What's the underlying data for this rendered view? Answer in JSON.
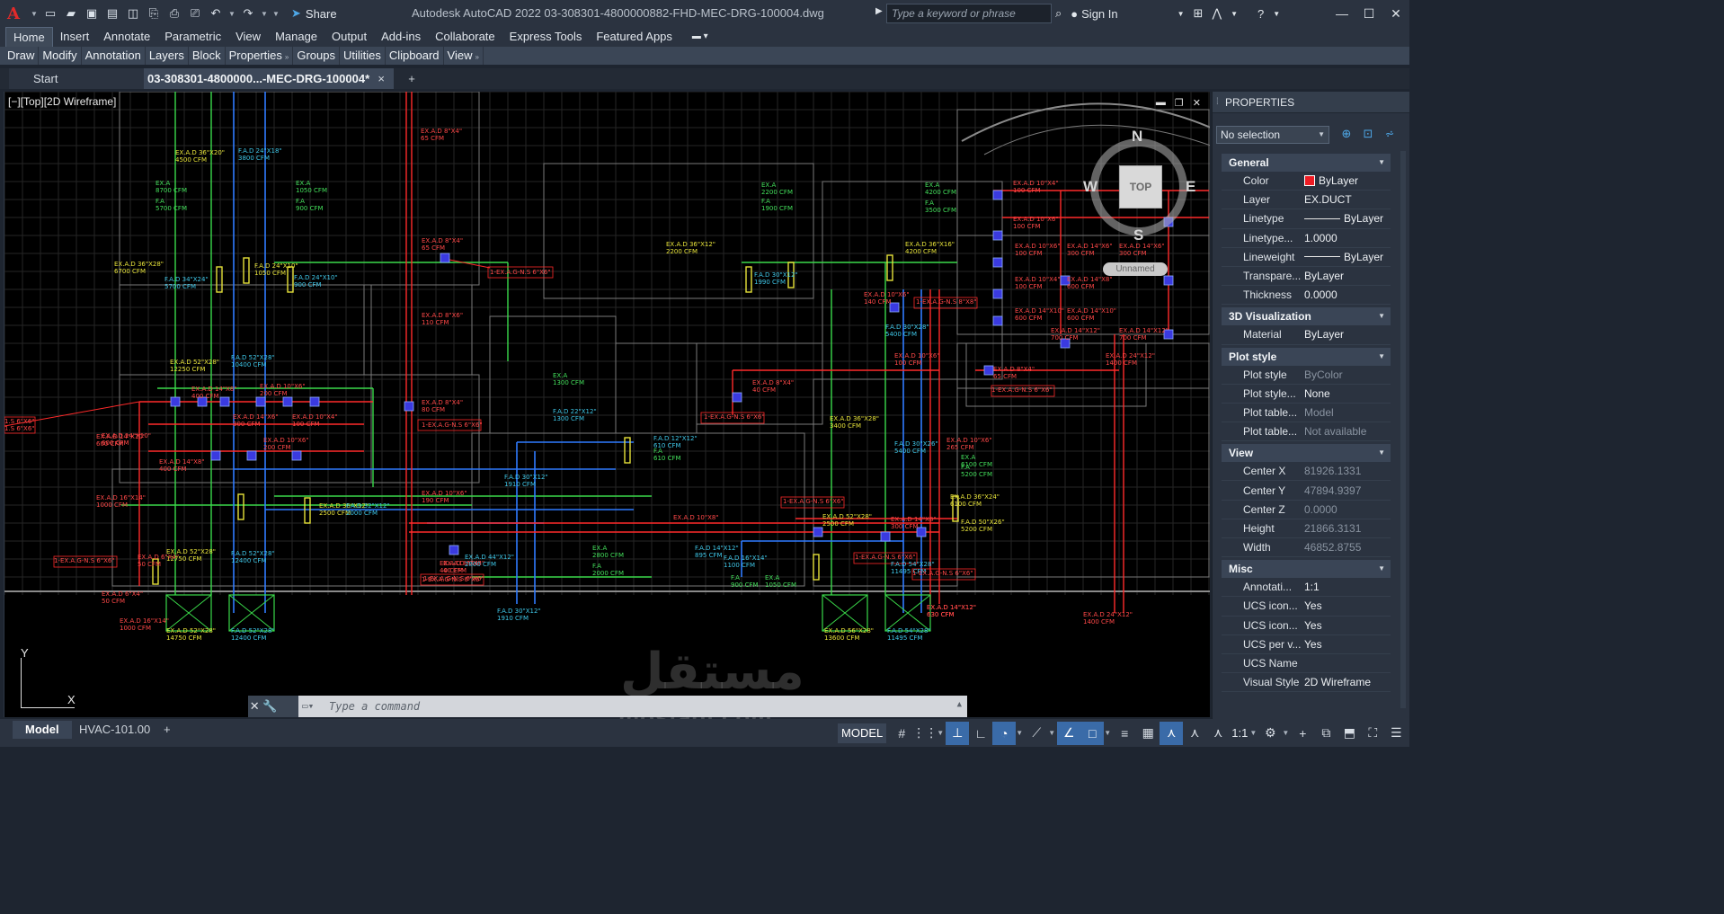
{
  "app": {
    "logo_letter": "A",
    "title": "Autodesk AutoCAD 2022    03-308301-4800000882-FHD-MEC-DRG-100004.dwg",
    "share_label": "Share",
    "search_placeholder": "Type a keyword or phrase",
    "sign_in": "Sign In"
  },
  "ribbon": {
    "tabs": [
      "Home",
      "Insert",
      "Annotate",
      "Parametric",
      "View",
      "Manage",
      "Output",
      "Add-ins",
      "Collaborate",
      "Express Tools",
      "Featured Apps"
    ],
    "active_tab": "Home",
    "panels": [
      "Draw",
      "Modify",
      "Annotation",
      "Layers",
      "Block",
      "Properties",
      "Groups",
      "Utilities",
      "Clipboard",
      "View"
    ]
  },
  "file_tabs": {
    "start": "Start",
    "current": "03-308301-4800000...-MEC-DRG-100004*",
    "close": "×",
    "add": "+"
  },
  "viewport": {
    "label": "[−][Top][2D Wireframe]",
    "viewcube": {
      "top": "TOP",
      "north": "N",
      "south": "S",
      "west": "W",
      "east": "E",
      "ucs_name": "Unnamed"
    },
    "ucs_x": "X",
    "ucs_y": "Y"
  },
  "annotations": [
    {
      "t": "EX.A.D 36\"X20\"\n4500 CFM",
      "c": "y"
    },
    {
      "t": "F.A.D 24\"X18\"\n3800 CFM",
      "c": "c"
    },
    {
      "t": "EX.A.D 8\"X4\"\n65 CFM",
      "c": "r"
    },
    {
      "t": "EX.A\n8700 CFM",
      "c": "g"
    },
    {
      "t": "F.A\n5700 CFM",
      "c": "g"
    },
    {
      "t": "EX.A\n1050 CFM",
      "c": "g"
    },
    {
      "t": "F.A\n900 CFM",
      "c": "g"
    },
    {
      "t": "EX.A.D 36\"X28\"\n6700 CFM",
      "c": "y"
    },
    {
      "t": "F.A.D 24\"X10\"\n1050 CFM",
      "c": "y"
    },
    {
      "t": "F.A.D 34\"X24\"\n5700 CFM",
      "c": "c"
    },
    {
      "t": "F.A.D 24\"X10\"\n900 CFM",
      "c": "c"
    },
    {
      "t": "EX.A.D 8\"X4\"\n65 CFM",
      "c": "r"
    },
    {
      "t": "1-EX.A.G-N.S 6\"X6\"",
      "c": "r"
    },
    {
      "t": "EX.A.D 8\"X6\"\n110 CFM",
      "c": "r"
    },
    {
      "t": "EX.A.D 52\"X28\"\n12250 CFM",
      "c": "y"
    },
    {
      "t": "F.A.D 52\"X28\"\n10400 CFM",
      "c": "c"
    },
    {
      "t": "EX.A.D 14\"X8\"\n400 CFM",
      "c": "r"
    },
    {
      "t": "EX.A.D 10\"X6\"\n200 CFM",
      "c": "r"
    },
    {
      "t": "EX.A.D 14\"X10\"\n600 CFM",
      "c": "r"
    },
    {
      "t": "EX.A.D 14\"X6\"\n300 CFM",
      "c": "r"
    },
    {
      "t": "EX.A.D 10\"X4\"\n100 CFM",
      "c": "r"
    },
    {
      "t": "EX.A.D 8\"X4\"\n80 CFM",
      "c": "r"
    },
    {
      "t": "1-EX.A.G-N.S 6\"X6\"",
      "c": "r"
    },
    {
      "t": "EX.A.D 14\"X10\"\n600 CFM",
      "c": "r"
    },
    {
      "t": "EX.A.D 14\"X8\"\n400 CFM",
      "c": "r"
    },
    {
      "t": "EX.A.D 10\"X6\"\n200 CFM",
      "c": "r"
    },
    {
      "t": "EX.A.D 16\"X14\"\n1000 CFM",
      "c": "r"
    },
    {
      "t": "EX.A.D 36\"X12\"\n2500 CFM",
      "c": "y"
    },
    {
      "t": "F.A.D 32\"X12\"\n2000 CFM",
      "c": "c"
    },
    {
      "t": "EX.A.D 10\"X6\"\n190 CFM",
      "c": "r"
    },
    {
      "t": "1-EX.A.G-N.S 6\"X6\"",
      "c": "r"
    },
    {
      "t": "EX.A.D 52\"X28\"\n12750 CFM",
      "c": "y"
    },
    {
      "t": "EX.A.D 6\"X4\"\n50 CFM",
      "c": "r"
    },
    {
      "t": "F.A.D 52\"X28\"\n12400 CFM",
      "c": "c"
    },
    {
      "t": "EX.A.D 8\"X4\"\n40 CFM",
      "c": "r"
    },
    {
      "t": "EX.A.D 16\"X14\"\n1000 CFM",
      "c": "r"
    },
    {
      "t": "EX.A.D 52\"X28\"\n14750 CFM",
      "c": "y"
    },
    {
      "t": "F.A.D 52\"X28\"\n12400 CFM",
      "c": "c"
    },
    {
      "t": "EX.A.D 8\"X8\"\n40 CFM",
      "c": "r"
    },
    {
      "t": "EX.A.D 44\"X12\"\n2800 CFM",
      "c": "c"
    },
    {
      "t": "1-EX.A.G-N.S 6\"X6\"",
      "c": "r"
    },
    {
      "t": "EX.A\n1300 CFM",
      "c": "g"
    },
    {
      "t": "F.A.D 22\"X12\"\n1300 CFM",
      "c": "c"
    },
    {
      "t": "F.A.D 12\"X12\"\n610 CFM",
      "c": "c"
    },
    {
      "t": "F.A\n610 CFM",
      "c": "g"
    },
    {
      "t": "F.A.D 30\"X12\"\n1910 CFM",
      "c": "c"
    },
    {
      "t": "F.A.D 30\"X12\"\n1910 CFM",
      "c": "c"
    },
    {
      "t": "EX.A\n2800 CFM",
      "c": "g"
    },
    {
      "t": "F.A\n2000 CFM",
      "c": "g"
    },
    {
      "t": "EX.A.D 10\"X8\"",
      "c": "r"
    },
    {
      "t": "F.A.D 14\"X12\"\n895 CFM",
      "c": "c"
    },
    {
      "t": "F.A.D 16\"X14\"\n1100 CFM",
      "c": "c"
    },
    {
      "t": "F.A\n900 CFM",
      "c": "g"
    },
    {
      "t": "EX.A\n1050 CFM",
      "c": "g"
    },
    {
      "t": "EX.A\n2200 CFM",
      "c": "g"
    },
    {
      "t": "F.A\n1900 CFM",
      "c": "g"
    },
    {
      "t": "EX.A.D 36\"X12\"\n2200 CFM",
      "c": "y"
    },
    {
      "t": "F.A.D 30\"X12\"\n1990 CFM",
      "c": "c"
    },
    {
      "t": "EX.A.D 8\"X4\"\n40 CFM",
      "c": "r"
    },
    {
      "t": "1-EX.A.G-N.S 6\"X6\"",
      "c": "r"
    },
    {
      "t": "EX.A.D 36\"X28\"\n3400 CFM",
      "c": "y"
    },
    {
      "t": "EX.A\n4200 CFM",
      "c": "g"
    },
    {
      "t": "F.A\n3500 CFM",
      "c": "g"
    },
    {
      "t": "EX.A.D 36\"X16\"\n4200 CFM",
      "c": "y"
    },
    {
      "t": "EX.A.D 10\"X6\"\n140 CFM",
      "c": "r"
    },
    {
      "t": "1-EX.A.G-N.S 8\"X8\"",
      "c": "r"
    },
    {
      "t": "F.A.D 30\"X28\"\n5400 CFM",
      "c": "c"
    },
    {
      "t": "EX.A.D 10\"X6\"\n100 CFM",
      "c": "r"
    },
    {
      "t": "F.A.D 30\"X26\"\n5400 CFM",
      "c": "c"
    },
    {
      "t": "EX.A.D 10\"X6\"\n265 CFM",
      "c": "r"
    },
    {
      "t": "F.A\n5200 CFM",
      "c": "g"
    },
    {
      "t": "EX.A\n6100 CFM",
      "c": "g"
    },
    {
      "t": "EX.A.D 36\"X24\"\n6100 CFM",
      "c": "y"
    },
    {
      "t": "F.A.D 50\"X26\"\n5200 CFM",
      "c": "y"
    },
    {
      "t": "1-EX.A.G-N.S 6\"X6\"",
      "c": "r"
    },
    {
      "t": "EX.A.D 52\"X28\"\n2500 CFM",
      "c": "y"
    },
    {
      "t": "EX.A.D 14\"X8\"\n300 CFM",
      "c": "r"
    },
    {
      "t": "1-EX.A.G-N.S 6\"X6\"",
      "c": "r"
    },
    {
      "t": "F.A.D 54\"X28\"\n11495 CFM",
      "c": "c"
    },
    {
      "t": "1-EX.A.G-N.S 6\"X6\"",
      "c": "r"
    },
    {
      "t": "EX.A.D 14\"X12\"\n630 CFM",
      "c": "r"
    },
    {
      "t": "EX.A.D 56\"X28\"\n13600 CFM",
      "c": "y"
    },
    {
      "t": "F.A.D 54\"X28\"\n11495 CFM",
      "c": "c"
    },
    {
      "t": "EX.A.D 14\"X12\"\n630 CFM",
      "c": "r"
    },
    {
      "t": "EX.A.D 24\"X12\"\n1400 CFM",
      "c": "r"
    },
    {
      "t": "EX.A.D 10\"X4\"\n100 CFM",
      "c": "r"
    },
    {
      "t": "EX.A.D 10\"X6\"\n100 CFM",
      "c": "r"
    },
    {
      "t": "EX.A.D 14\"X6\"\n300 CFM",
      "c": "r"
    },
    {
      "t": "EX.A.D 14\"X6\"\n300 CFM",
      "c": "r"
    },
    {
      "t": "EX.A.D 10\"X6\"\n100 CFM",
      "c": "r"
    },
    {
      "t": "EX.A.D 14\"X8\"\n600 CFM",
      "c": "r"
    },
    {
      "t": "EX.A.D 10\"X4\"\n100 CFM",
      "c": "r"
    },
    {
      "t": "EX.A.D 14\"X10\"\n600 CFM",
      "c": "r"
    },
    {
      "t": "EX.A.D 14\"X10\"\n600 CFM",
      "c": "r"
    },
    {
      "t": "EX.A.D 14\"X12\"\n700 CFM",
      "c": "r"
    },
    {
      "t": "EX.A.D 14\"X12\"\n700 CFM",
      "c": "r"
    },
    {
      "t": "EX.A.D 24\"X12\"\n1400 CFM",
      "c": "r"
    },
    {
      "t": "EX.A.D 8\"X4\"\n65 CFM",
      "c": "r"
    },
    {
      "t": "1-EX.A.G-N.S 6\"X6\"",
      "c": "r"
    },
    {
      "t": "1.S 6\"X6\"\n1.S 6\"X6\"",
      "c": "r"
    },
    {
      "t": "1-EX.A.G-N.S 6\"X6\"",
      "c": "r"
    },
    {
      "t": "EX.A.D 6\"X4\"\n50 CFM",
      "c": "r"
    }
  ],
  "command": {
    "placeholder": "Type a command"
  },
  "watermark": {
    "arabic": "مستقل",
    "latin": "mostaql.com"
  },
  "layout_tabs": {
    "model": "Model",
    "layout1": "HVAC-101.00",
    "add": "+"
  },
  "status_bar": {
    "model_label": "MODEL",
    "scale": "1:1"
  },
  "properties": {
    "title": "PROPERTIES",
    "selection": "No selection",
    "sections": [
      {
        "name": "General",
        "rows": [
          {
            "k": "Color",
            "v": "ByLayer",
            "kind": "color"
          },
          {
            "k": "Layer",
            "v": "EX.DUCT"
          },
          {
            "k": "Linetype",
            "v": "ByLayer",
            "kind": "line"
          },
          {
            "k": "Linetype...",
            "v": "1.0000"
          },
          {
            "k": "Lineweight",
            "v": "ByLayer",
            "kind": "line"
          },
          {
            "k": "Transpare...",
            "v": "ByLayer"
          },
          {
            "k": "Thickness",
            "v": "0.0000"
          }
        ]
      },
      {
        "name": "3D Visualization",
        "rows": [
          {
            "k": "Material",
            "v": "ByLayer"
          }
        ]
      },
      {
        "name": "Plot style",
        "rows": [
          {
            "k": "Plot style",
            "v": "ByColor",
            "dim": true
          },
          {
            "k": "Plot style...",
            "v": "None"
          },
          {
            "k": "Plot table...",
            "v": "Model",
            "dim": true
          },
          {
            "k": "Plot table...",
            "v": "Not available",
            "dim": true
          }
        ]
      },
      {
        "name": "View",
        "rows": [
          {
            "k": "Center X",
            "v": "81926.1331",
            "dim": true
          },
          {
            "k": "Center Y",
            "v": "47894.9397",
            "dim": true
          },
          {
            "k": "Center Z",
            "v": "0.0000",
            "dim": true
          },
          {
            "k": "Height",
            "v": "21866.3131",
            "dim": true
          },
          {
            "k": "Width",
            "v": "46852.8755",
            "dim": true
          }
        ]
      },
      {
        "name": "Misc",
        "rows": [
          {
            "k": "Annotati...",
            "v": "1:1"
          },
          {
            "k": "UCS icon...",
            "v": "Yes"
          },
          {
            "k": "UCS icon...",
            "v": "Yes"
          },
          {
            "k": "UCS per v...",
            "v": "Yes"
          },
          {
            "k": "UCS Name",
            "v": ""
          },
          {
            "k": "Visual Style",
            "v": "2D Wireframe"
          }
        ]
      }
    ]
  },
  "colors": {
    "exhaust": "#ff2a2a",
    "supply": "#2f7bff",
    "outdoor": "#3ad94a",
    "label": "#e6e23a",
    "accent": "#3a6ba8"
  }
}
